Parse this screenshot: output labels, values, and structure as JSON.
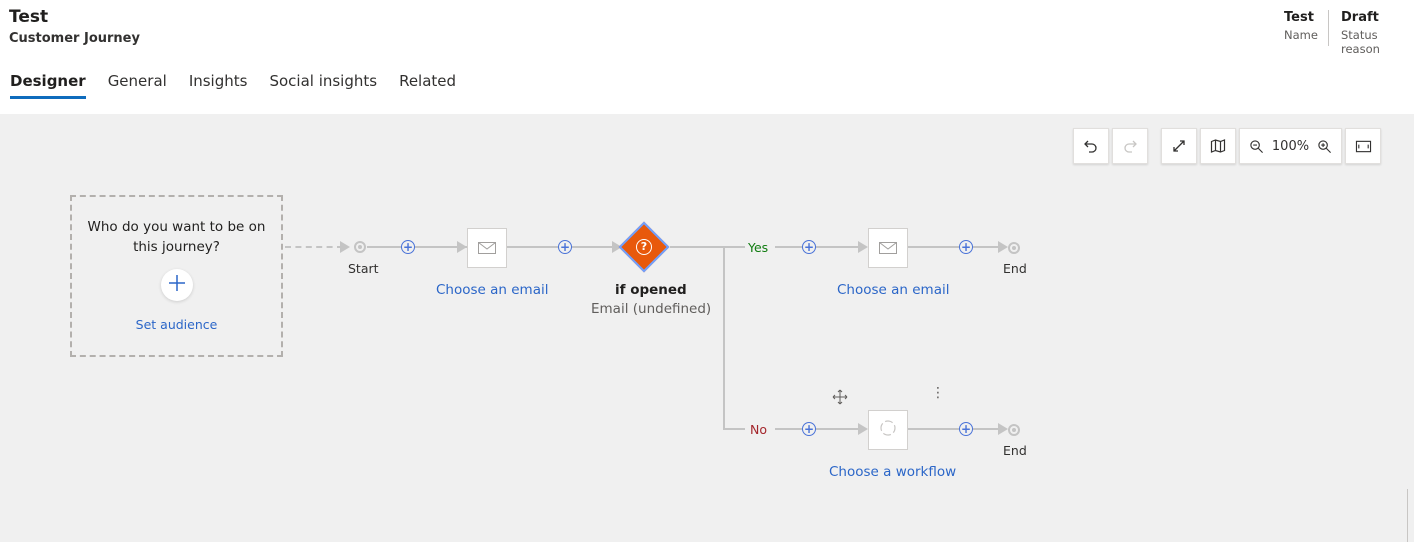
{
  "header": {
    "title": "Test",
    "subtitle": "Customer Journey",
    "fields": [
      {
        "value": "Test",
        "label": "Name"
      },
      {
        "value": "Draft",
        "label": "Status reason"
      }
    ]
  },
  "tabs": [
    {
      "label": "Designer",
      "active": true
    },
    {
      "label": "General",
      "active": false
    },
    {
      "label": "Insights",
      "active": false
    },
    {
      "label": "Social insights",
      "active": false
    },
    {
      "label": "Related",
      "active": false
    }
  ],
  "toolbar": {
    "undo_icon": "undo-icon",
    "redo_icon": "redo-icon",
    "expand_icon": "expand-icon",
    "map_icon": "map-icon",
    "zoom_out_icon": "zoom-out-icon",
    "zoom_level": "100%",
    "zoom_in_icon": "zoom-in-icon",
    "fit_icon": "fit-to-screen-icon"
  },
  "audience": {
    "question": "Who do you want to be on this journey?",
    "link": "Set audience"
  },
  "flow": {
    "start_label": "Start",
    "email1_label": "Choose an email",
    "condition_title": "if opened",
    "condition_subtitle": "Email (undefined)",
    "yes_label": "Yes",
    "no_label": "No",
    "email2_label": "Choose an email",
    "workflow_label": "Choose a workflow",
    "end_label_top": "End",
    "end_label_bottom": "End"
  },
  "colors": {
    "accent": "#0f6cbd",
    "link": "#2b66c8",
    "condition": "#e8590c",
    "yes": "#107c10",
    "no": "#a4262c"
  }
}
